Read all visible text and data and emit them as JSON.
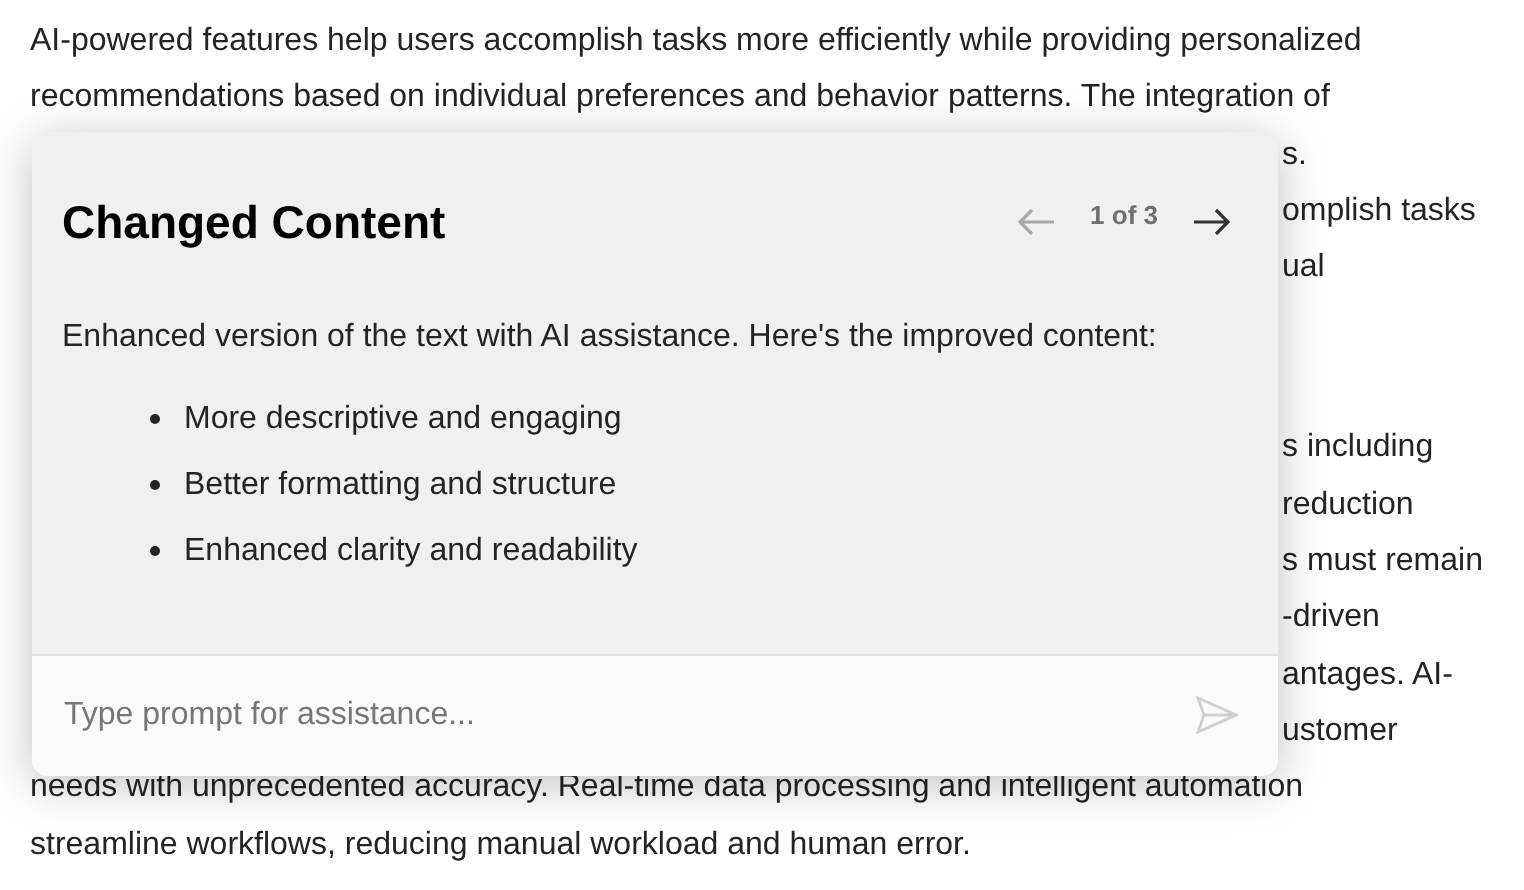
{
  "document": {
    "paragraphs": [
      {
        "lines": [
          {
            "kind": "full",
            "text": "AI-powered features help users accomplish tasks more efficiently while providing personalized"
          },
          {
            "kind": "full",
            "text": "recommendations based on individual preferences and behavior patterns. The integration of"
          },
          {
            "kind": "fragment",
            "text": "s."
          },
          {
            "kind": "fragment",
            "text": "omplish tasks"
          },
          {
            "kind": "fragment",
            "text": "ual"
          }
        ]
      },
      {
        "lines": [
          {
            "kind": "fragment",
            "text": "s including"
          },
          {
            "kind": "fragment",
            "text": "reduction"
          },
          {
            "kind": "fragment",
            "text": "s must remain"
          },
          {
            "kind": "fragment",
            "text": "-driven"
          },
          {
            "kind": "fragment",
            "text": "antages. AI-"
          },
          {
            "kind": "fragment",
            "text": "ustomer"
          },
          {
            "kind": "full",
            "text": "needs with unprecedented accuracy. Real-time data processing and intelligent automation"
          },
          {
            "kind": "full",
            "text": "streamline workflows, reducing manual workload and human error."
          }
        ]
      }
    ]
  },
  "popup": {
    "title": "Changed Content",
    "pager": {
      "label": "1 of 3",
      "previous_disabled": true,
      "next_disabled": false
    },
    "intro": "Enhanced version of the text with AI assistance. Here's the improved content:",
    "bullets": [
      "More descriptive and engaging",
      "Better formatting and structure",
      "Enhanced clarity and readability"
    ],
    "prompt": {
      "placeholder": "Type prompt for assistance..."
    }
  }
}
